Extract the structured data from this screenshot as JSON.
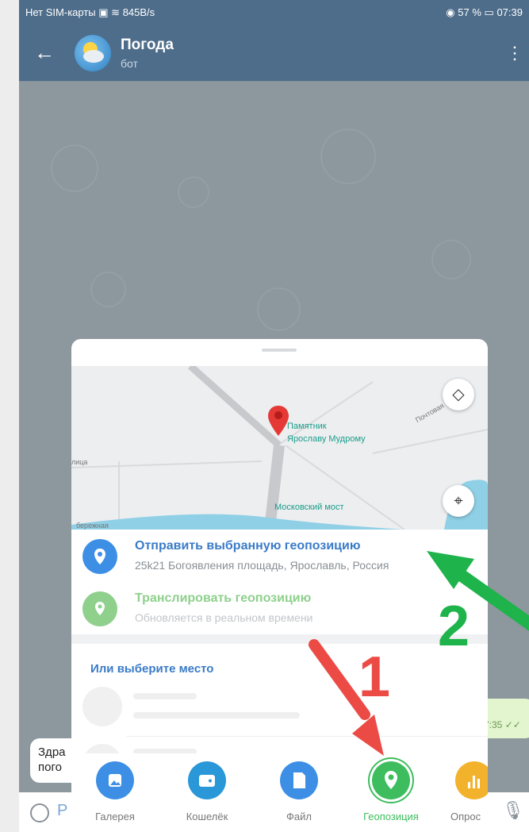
{
  "status_bar": {
    "left": "Нет SIM-карты",
    "speed": "845B/s",
    "battery": "57 %",
    "time": "07:39"
  },
  "header": {
    "title": "Погода",
    "subtitle": "бот"
  },
  "map": {
    "landmark_label_line1": "Памятник",
    "landmark_label_line2": "Ярославу Мудрому",
    "bridge_label": "Московский мост",
    "road_label_1": "Почтовая",
    "road_label_2": "лица",
    "road_label_3": "бережная"
  },
  "location_options": [
    {
      "title": "Отправить выбранную геопозицию",
      "subtitle": "25k21 Богоявления площадь, Ярославль, Россия"
    },
    {
      "title": "Транслировать геопозицию",
      "subtitle": "Обновляется в реальном времени"
    }
  ],
  "places": {
    "title": "Или выберите место"
  },
  "tabs": [
    {
      "label": "Галерея",
      "color": "#3d8fe6"
    },
    {
      "label": "Кошелёк",
      "color": "#2a97d8"
    },
    {
      "label": "Файл",
      "color": "#3d8fe6"
    },
    {
      "label": "Геопозиция",
      "color": "#3dbd5e",
      "active": true
    },
    {
      "label": "Опрос",
      "color": "#f3b22b"
    }
  ],
  "chat": {
    "incoming_fragment": "Здра\nпого",
    "outgoing_time": "7:35 ✓✓",
    "input_fragment": "Р"
  },
  "annotations": {
    "marker_1": "1",
    "marker_2": "2"
  },
  "colors": {
    "header": "#4e6d8a",
    "accent": "#3a7bc8",
    "live_green": "#8ed08c",
    "arrow_red": "#ec4b45",
    "arrow_green": "#1fb34b"
  }
}
